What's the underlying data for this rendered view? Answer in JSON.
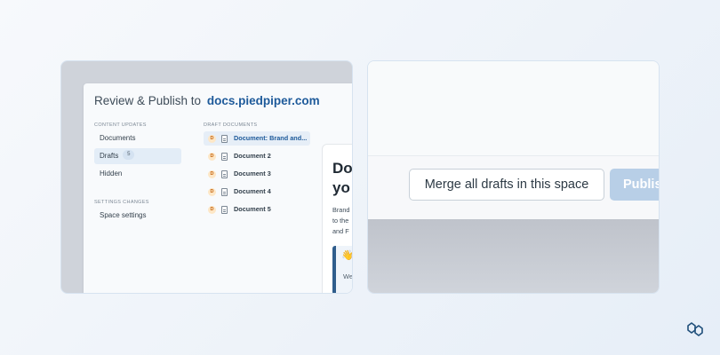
{
  "dialog": {
    "title_prefix": "Review & Publish to",
    "title_domain": "docs.piedpiper.com",
    "content_updates_heading": "CONTENT UPDATES",
    "nav": [
      {
        "label": "Documents"
      },
      {
        "label": "Drafts",
        "count": "5"
      },
      {
        "label": "Hidden"
      }
    ],
    "settings_heading": "SETTINGS CHANGES",
    "settings_item": "Space settings",
    "drafts_heading": "DRAFT DOCUMENTS",
    "draft_badge": "D",
    "drafts": [
      {
        "label": "Document: Brand and..."
      },
      {
        "label": "Document 2"
      },
      {
        "label": "Document 3"
      },
      {
        "label": "Document 4"
      },
      {
        "label": "Document 5"
      }
    ]
  },
  "preview": {
    "heading": "Do\nyo",
    "body": "Brand\nto the\nand F",
    "callout_emoji": "👋",
    "callout_text": "We"
  },
  "actions": {
    "merge_label": "Merge all drafts in this space",
    "publish_label": "Publis"
  },
  "colors": {
    "accent": "#1e5a9a",
    "publish_button": "#b8cfe7",
    "draft_badge_bg": "#fde7c7"
  }
}
